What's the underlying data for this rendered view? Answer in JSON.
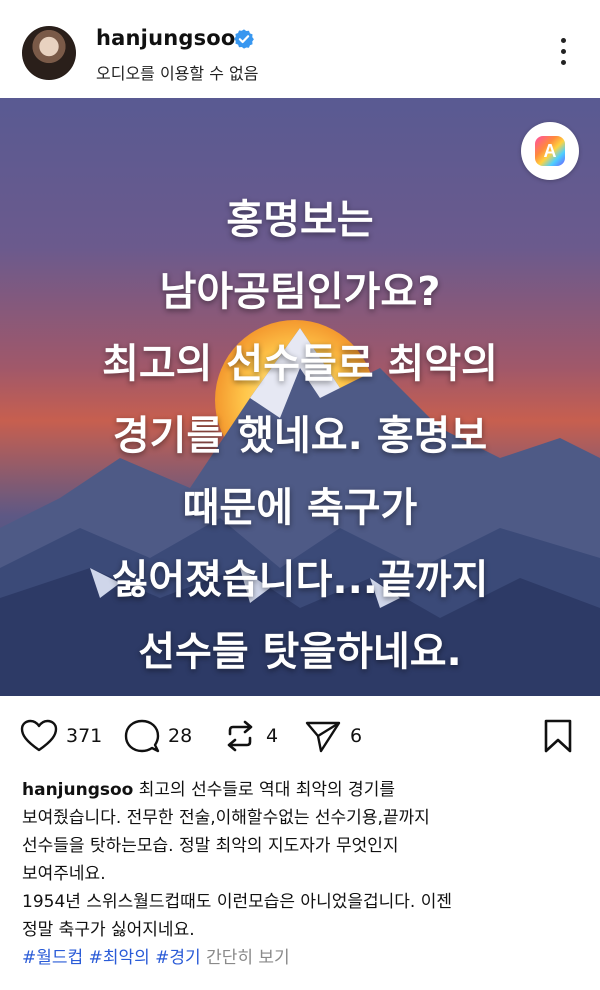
{
  "header": {
    "username": "hanjungsoo",
    "subtitle": "오디오를 이용할 수 없음"
  },
  "post_image": {
    "text_lines": [
      "홍명보는",
      "남아공팀인가요?",
      "최고의 선수들로 최악의",
      "경기를 했네요. 홍명보",
      "때문에 축구가",
      "싫어졌습니다...끝까지",
      "선수들 탓을하네요."
    ],
    "badge_letter": "A"
  },
  "actions": {
    "likes": "371",
    "comments": "28",
    "reposts": "4",
    "shares": "6"
  },
  "caption": {
    "username": "hanjungsoo",
    "lines": [
      " 최고의 선수들로 역대 최악의 경기를",
      "보여줬습니다. 전무한 전술,이해할수없는 선수기용,끝까지",
      "선수들을 탓하는모습. 정말 최악의 지도자가 무엇인지",
      "보여주네요.",
      "1954년 스위스월드컵때도 이런모습은 아니었을겁니다. 이젠",
      "정말 축구가 싫어지네요."
    ],
    "hashtags": [
      "#월드컵",
      "#최악의",
      "#경기"
    ],
    "see_more": "간단히 보기"
  },
  "colors": {
    "verified_blue": "#3897f0",
    "hashtag_blue": "#2a5bd7"
  }
}
